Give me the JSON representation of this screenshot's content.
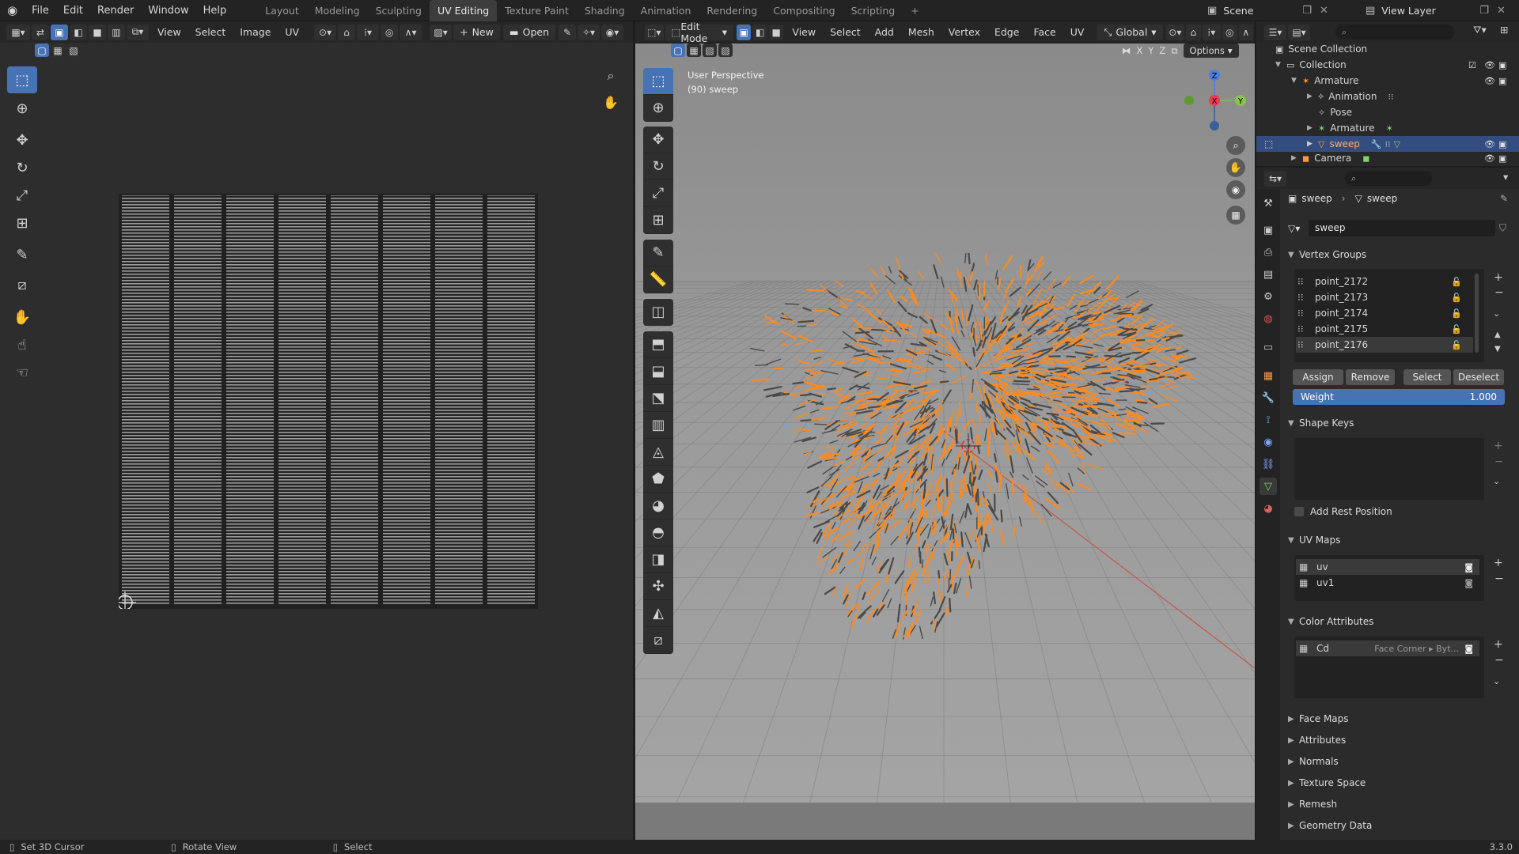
{
  "topbar": {
    "menus": [
      "File",
      "Edit",
      "Render",
      "Window",
      "Help"
    ],
    "workspaces": [
      "Layout",
      "Modeling",
      "Sculpting",
      "UV Editing",
      "Texture Paint",
      "Shading",
      "Animation",
      "Rendering",
      "Compositing",
      "Scripting"
    ],
    "active_workspace": "UV Editing",
    "add_tab": "+",
    "scene": "Scene",
    "view_layer": "View Layer"
  },
  "uv_editor": {
    "menus": [
      "View",
      "Select",
      "Image",
      "UV"
    ],
    "new_label": "New",
    "open_label": "Open"
  },
  "viewport": {
    "mode": "Edit Mode",
    "menus": [
      "View",
      "Select",
      "Add",
      "Mesh",
      "Vertex",
      "Edge",
      "Face",
      "UV"
    ],
    "orientation": "Global",
    "options_label": "Options",
    "axes": [
      "X",
      "Y",
      "Z"
    ],
    "overlay_line1": "User Perspective",
    "overlay_line2": "(90) sweep",
    "gizmo": {
      "x": "X",
      "y": "Y",
      "z": "Z"
    }
  },
  "outliner": {
    "scene_collection": "Scene Collection",
    "collection": "Collection",
    "items": [
      {
        "label": "Armature",
        "indent": 1
      },
      {
        "label": "Animation",
        "indent": 2
      },
      {
        "label": "Pose",
        "indent": 2
      },
      {
        "label": "Armature",
        "indent": 2
      },
      {
        "label": "sweep",
        "indent": 2
      },
      {
        "label": "Camera",
        "indent": 1
      }
    ]
  },
  "properties": {
    "breadcrumb_object": "sweep",
    "breadcrumb_data": "sweep",
    "data_name": "sweep",
    "vertex_groups_title": "Vertex Groups",
    "vertex_groups": [
      "point_2172",
      "point_2173",
      "point_2174",
      "point_2175",
      "point_2176"
    ],
    "assign": "Assign",
    "remove": "Remove",
    "select": "Select",
    "deselect": "Deselect",
    "weight_label": "Weight",
    "weight_value": "1.000",
    "shape_keys_title": "Shape Keys",
    "add_rest_position": "Add Rest Position",
    "uv_maps_title": "UV Maps",
    "uv_maps": [
      "uv",
      "uv1"
    ],
    "color_attributes_title": "Color Attributes",
    "color_attr_name": "Cd",
    "color_attr_domain": "Face Corner ▸ Byt...",
    "collapsed_sections": [
      "Face Maps",
      "Attributes",
      "Normals",
      "Texture Space",
      "Remesh",
      "Geometry Data"
    ]
  },
  "statusbar": {
    "left": "Set 3D Cursor",
    "middle": "Rotate View",
    "right": "Select",
    "version": "3.3.0"
  },
  "colors": {
    "accent": "#4772b3",
    "selection_orange": "#ff8a1c",
    "viewport_bg": "#8e8e8e"
  }
}
